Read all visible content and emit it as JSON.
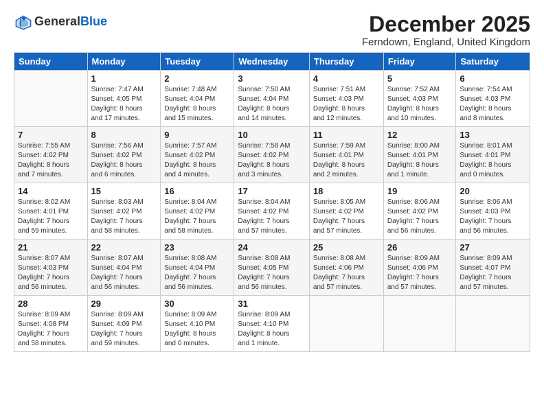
{
  "logo": {
    "general": "General",
    "blue": "Blue"
  },
  "header": {
    "month": "December 2025",
    "location": "Ferndown, England, United Kingdom"
  },
  "weekdays": [
    "Sunday",
    "Monday",
    "Tuesday",
    "Wednesday",
    "Thursday",
    "Friday",
    "Saturday"
  ],
  "weeks": [
    [
      {
        "num": "",
        "info": ""
      },
      {
        "num": "1",
        "info": "Sunrise: 7:47 AM\nSunset: 4:05 PM\nDaylight: 8 hours\nand 17 minutes."
      },
      {
        "num": "2",
        "info": "Sunrise: 7:48 AM\nSunset: 4:04 PM\nDaylight: 8 hours\nand 15 minutes."
      },
      {
        "num": "3",
        "info": "Sunrise: 7:50 AM\nSunset: 4:04 PM\nDaylight: 8 hours\nand 14 minutes."
      },
      {
        "num": "4",
        "info": "Sunrise: 7:51 AM\nSunset: 4:03 PM\nDaylight: 8 hours\nand 12 minutes."
      },
      {
        "num": "5",
        "info": "Sunrise: 7:52 AM\nSunset: 4:03 PM\nDaylight: 8 hours\nand 10 minutes."
      },
      {
        "num": "6",
        "info": "Sunrise: 7:54 AM\nSunset: 4:03 PM\nDaylight: 8 hours\nand 8 minutes."
      }
    ],
    [
      {
        "num": "7",
        "info": "Sunrise: 7:55 AM\nSunset: 4:02 PM\nDaylight: 8 hours\nand 7 minutes."
      },
      {
        "num": "8",
        "info": "Sunrise: 7:56 AM\nSunset: 4:02 PM\nDaylight: 8 hours\nand 6 minutes."
      },
      {
        "num": "9",
        "info": "Sunrise: 7:57 AM\nSunset: 4:02 PM\nDaylight: 8 hours\nand 4 minutes."
      },
      {
        "num": "10",
        "info": "Sunrise: 7:58 AM\nSunset: 4:02 PM\nDaylight: 8 hours\nand 3 minutes."
      },
      {
        "num": "11",
        "info": "Sunrise: 7:59 AM\nSunset: 4:01 PM\nDaylight: 8 hours\nand 2 minutes."
      },
      {
        "num": "12",
        "info": "Sunrise: 8:00 AM\nSunset: 4:01 PM\nDaylight: 8 hours\nand 1 minute."
      },
      {
        "num": "13",
        "info": "Sunrise: 8:01 AM\nSunset: 4:01 PM\nDaylight: 8 hours\nand 0 minutes."
      }
    ],
    [
      {
        "num": "14",
        "info": "Sunrise: 8:02 AM\nSunset: 4:01 PM\nDaylight: 7 hours\nand 59 minutes."
      },
      {
        "num": "15",
        "info": "Sunrise: 8:03 AM\nSunset: 4:02 PM\nDaylight: 7 hours\nand 58 minutes."
      },
      {
        "num": "16",
        "info": "Sunrise: 8:04 AM\nSunset: 4:02 PM\nDaylight: 7 hours\nand 58 minutes."
      },
      {
        "num": "17",
        "info": "Sunrise: 8:04 AM\nSunset: 4:02 PM\nDaylight: 7 hours\nand 57 minutes."
      },
      {
        "num": "18",
        "info": "Sunrise: 8:05 AM\nSunset: 4:02 PM\nDaylight: 7 hours\nand 57 minutes."
      },
      {
        "num": "19",
        "info": "Sunrise: 8:06 AM\nSunset: 4:02 PM\nDaylight: 7 hours\nand 56 minutes."
      },
      {
        "num": "20",
        "info": "Sunrise: 8:06 AM\nSunset: 4:03 PM\nDaylight: 7 hours\nand 56 minutes."
      }
    ],
    [
      {
        "num": "21",
        "info": "Sunrise: 8:07 AM\nSunset: 4:03 PM\nDaylight: 7 hours\nand 56 minutes."
      },
      {
        "num": "22",
        "info": "Sunrise: 8:07 AM\nSunset: 4:04 PM\nDaylight: 7 hours\nand 56 minutes."
      },
      {
        "num": "23",
        "info": "Sunrise: 8:08 AM\nSunset: 4:04 PM\nDaylight: 7 hours\nand 56 minutes."
      },
      {
        "num": "24",
        "info": "Sunrise: 8:08 AM\nSunset: 4:05 PM\nDaylight: 7 hours\nand 56 minutes."
      },
      {
        "num": "25",
        "info": "Sunrise: 8:08 AM\nSunset: 4:06 PM\nDaylight: 7 hours\nand 57 minutes."
      },
      {
        "num": "26",
        "info": "Sunrise: 8:09 AM\nSunset: 4:06 PM\nDaylight: 7 hours\nand 57 minutes."
      },
      {
        "num": "27",
        "info": "Sunrise: 8:09 AM\nSunset: 4:07 PM\nDaylight: 7 hours\nand 57 minutes."
      }
    ],
    [
      {
        "num": "28",
        "info": "Sunrise: 8:09 AM\nSunset: 4:08 PM\nDaylight: 7 hours\nand 58 minutes."
      },
      {
        "num": "29",
        "info": "Sunrise: 8:09 AM\nSunset: 4:09 PM\nDaylight: 7 hours\nand 59 minutes."
      },
      {
        "num": "30",
        "info": "Sunrise: 8:09 AM\nSunset: 4:10 PM\nDaylight: 8 hours\nand 0 minutes."
      },
      {
        "num": "31",
        "info": "Sunrise: 8:09 AM\nSunset: 4:10 PM\nDaylight: 8 hours\nand 1 minute."
      },
      {
        "num": "",
        "info": ""
      },
      {
        "num": "",
        "info": ""
      },
      {
        "num": "",
        "info": ""
      }
    ]
  ]
}
